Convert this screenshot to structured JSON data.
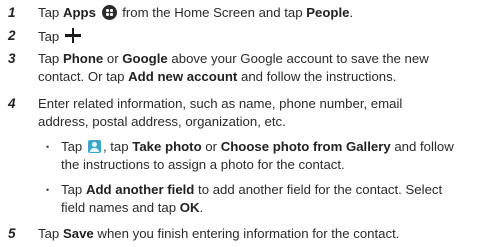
{
  "steps": [
    {
      "num": "1",
      "parts": [
        "Tap ",
        "Apps",
        " from the Home Screen and tap ",
        "People",
        "."
      ]
    },
    {
      "num": "2",
      "parts": [
        "Tap "
      ]
    },
    {
      "num": "3",
      "lines": [
        [
          "Tap ",
          "Phone",
          " or ",
          "Google",
          " above your Google account to save the new"
        ],
        [
          "contact. Or tap ",
          "Add new account",
          " and follow the instructions."
        ]
      ]
    },
    {
      "num": "4",
      "lines": [
        [
          "Enter related information, such as name, phone number, email"
        ],
        [
          "address, postal address, organization, etc."
        ]
      ],
      "bullets": [
        {
          "lines": [
            [
              "Tap ",
              ", tap ",
              "Take photo",
              " or ",
              "Choose photo from Gallery",
              " and follow"
            ],
            [
              "the instructions to assign a photo for the contact."
            ]
          ]
        },
        {
          "lines": [
            [
              "Tap ",
              "Add another field",
              " to add another field for the contact. Select"
            ],
            [
              "field names and tap ",
              "OK",
              "."
            ]
          ]
        }
      ]
    },
    {
      "num": "5",
      "parts": [
        "Tap ",
        "Save",
        " when you finish entering information for the contact."
      ]
    }
  ],
  "bullet_glyph": "•",
  "icons": [
    "apps-icon",
    "plus-icon",
    "contact-photo-icon"
  ]
}
